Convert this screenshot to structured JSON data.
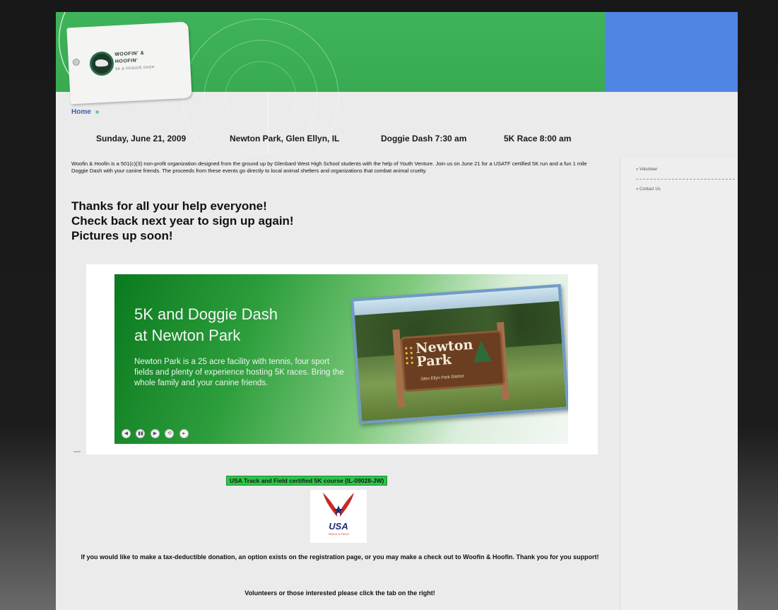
{
  "logo": {
    "line1": "WOOFIN' &",
    "line2": "HOOFIN'",
    "line3": "5K & DOGGIE DASH"
  },
  "breadcrumb": {
    "home": "Home",
    "arrow": "»"
  },
  "event": {
    "date": "Sunday, June 21, 2009",
    "location": "Newton Park, Glen Ellyn, IL",
    "dash_time": "Doggie Dash 7:30 am",
    "race_time": "5K Race 8:00 am"
  },
  "intro": "Woofin & Hoofin is a 501(c)(3) non-profit organization designed from the ground up by Glenbard West High School students with the help of Youth Venture. Join us on June 21 for a USATF certified 5K run and a fun 1 mile Doggie Dash with your canine friends. The proceeds from these events go directly to local animal shelters and organizations that combat animal cruelty.",
  "thanks": {
    "line1": "Thanks for all your help everyone!",
    "line2": "Check back next year to sign up again!",
    "line3": "Pictures up soon!"
  },
  "slide": {
    "title_line1": "5K and Doggie Dash",
    "title_line2": "at Newton Park",
    "body": "Newton Park is a 25 acre facility with tennis, four sport fields and plenty of experience hosting 5K races. Bring the whole family and your canine friends.",
    "sign_line1": "Newton",
    "sign_line2": "Park",
    "sign_sub": "Glen Ellyn Park District",
    "controls": [
      "◀",
      "▮▮",
      "▶",
      "⟲",
      "▸"
    ]
  },
  "certified": "USA Track and Field certified 5K course (IL-09028-JW)",
  "usa_logo": {
    "text": "USA",
    "sub": "TRACK & FIELD"
  },
  "donation": "If you would like to make a tax-deductible donation, an option exists on the registration page, or you may make a check out to Woofin & Hoofin. Thank you for you support!",
  "volunteer": "Volunteers or those interested please click the tab on the right!",
  "sidebar": {
    "volunteer": "» Volunteer",
    "contact": "» Contact Us"
  },
  "colors": {
    "banner_green": "#3fb35a",
    "banner_blue": "#4f86e6",
    "badge_green": "#2fc34a",
    "page_bg": "#ebebeb"
  }
}
